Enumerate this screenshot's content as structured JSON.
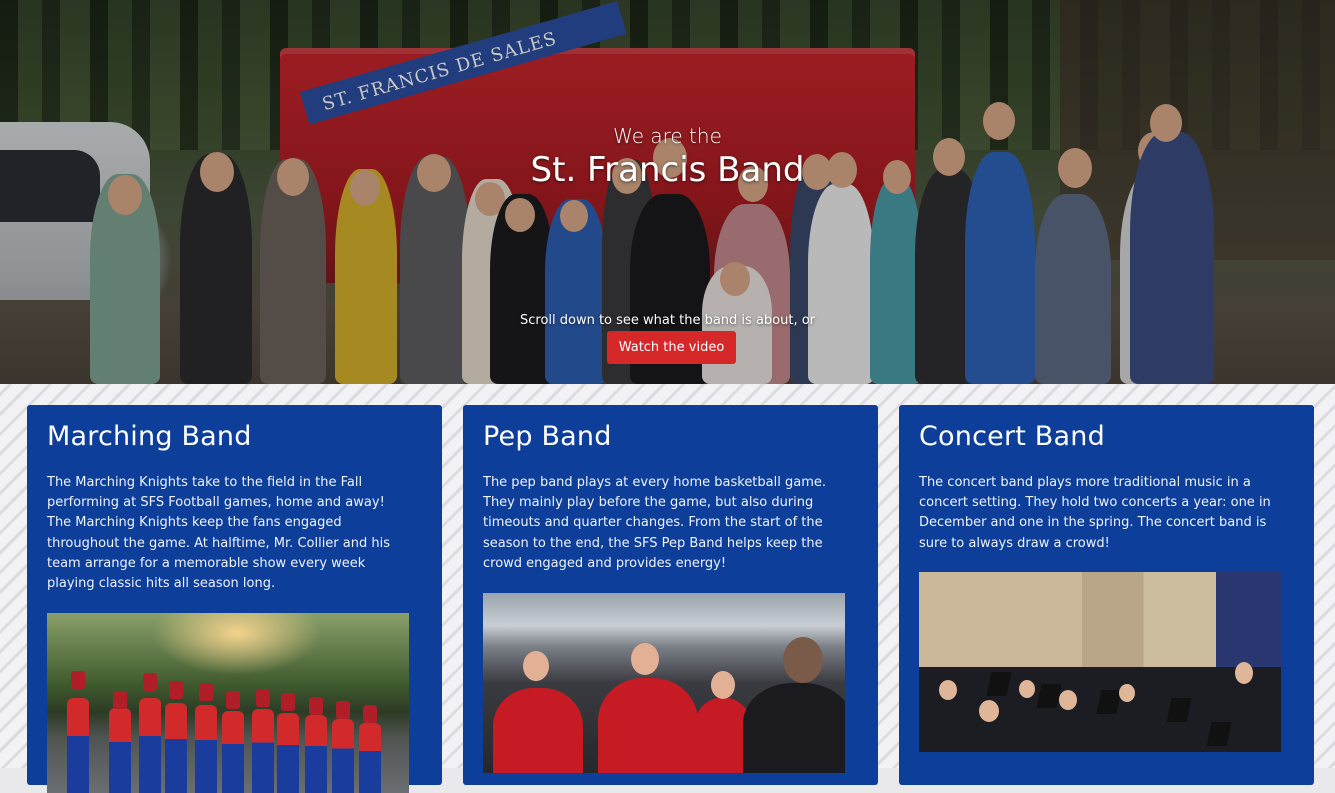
{
  "hero": {
    "subtitle": "We are the",
    "title": "St. Francis Band",
    "scroll_text": "Scroll down to see what the band is about, or",
    "watch_button": "Watch the video",
    "trailer_text": "ST. FRANCIS DE SALES",
    "colors": {
      "button": "#d62828",
      "trailer": "#c8262d"
    }
  },
  "cards": [
    {
      "title": "Marching Band",
      "body": "The Marching Knights take to the field in the Fall performing at SFS Football games, home and away! The Marching Knights keep the fans engaged throughout the game. At halftime, Mr. Collier and his team arrange for a memorable show every week playing classic hits all season long.",
      "image": "marching-band-photo"
    },
    {
      "title": "Pep Band",
      "body": "The pep band plays at every home basketball game. They mainly play before the game, but also during timeouts and quarter changes. From the start of the season to the end, the SFS Pep Band helps keep the crowd engaged and provides energy!",
      "image": "pep-band-photo"
    },
    {
      "title": "Concert Band",
      "body": "The concert band plays more traditional music in a concert setting. They hold two concerts a year: one in December and one in the spring. The concert band is sure to always draw a crowd!",
      "image": "concert-band-photo"
    }
  ],
  "colors": {
    "card": "#0d3f9a",
    "card_text": "#ffffff"
  }
}
